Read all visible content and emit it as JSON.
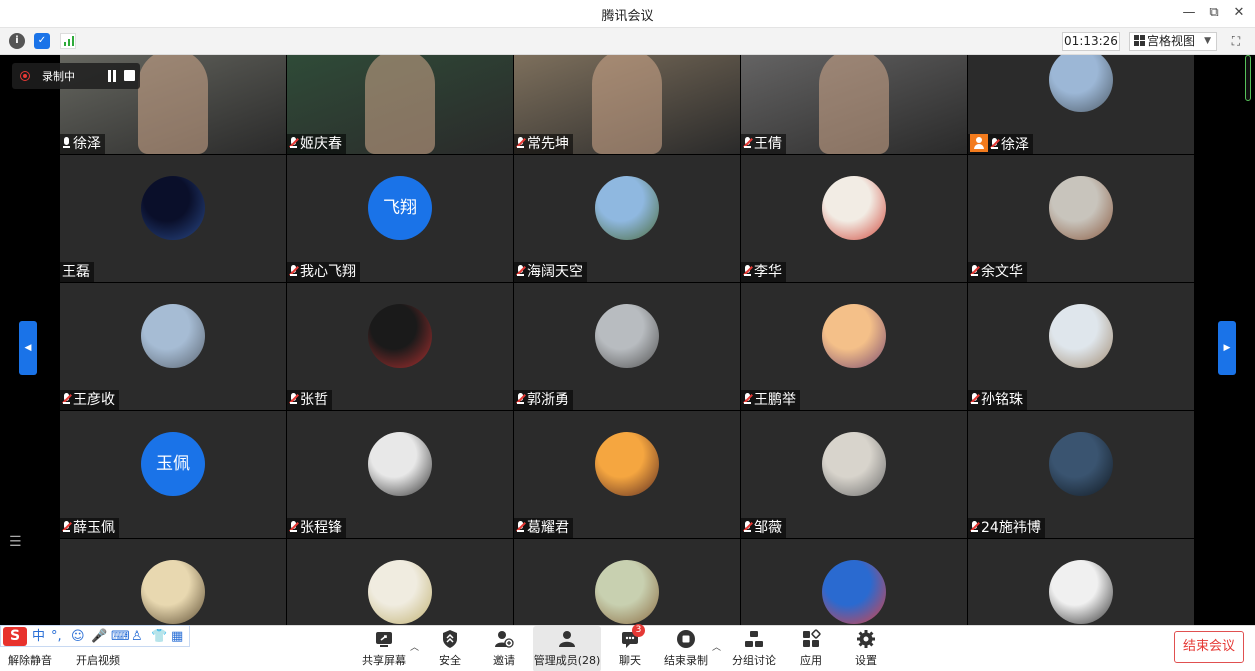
{
  "window": {
    "title": "腾讯会议",
    "minimize": "—",
    "restore": "⧉",
    "close": "✕"
  },
  "status": {
    "timer": "01:13:26",
    "view_label": "宫格视图",
    "view_caret": "▼",
    "fullscreen": "⛶",
    "info": "i",
    "shield": "✓"
  },
  "recording": {
    "label": "录制中"
  },
  "tiles": [
    {
      "name": "徐泽",
      "mic": "on",
      "kind": "video",
      "bg": "#6f7068"
    },
    {
      "name": "姬庆春",
      "mic": "muted",
      "kind": "video",
      "bg": "#30503a"
    },
    {
      "name": "常先坤",
      "mic": "muted",
      "kind": "video",
      "bg": "#8a7a64"
    },
    {
      "name": "王倩",
      "mic": "muted",
      "kind": "video",
      "bg": "#6d6c6c"
    },
    {
      "name": "徐泽",
      "mic": "muted",
      "kind": "avatar",
      "host": true,
      "c1": "#9cb7d6",
      "c2": "#4d5a66"
    },
    {
      "name": "王磊",
      "mic": "none",
      "kind": "avatar",
      "c1": "#0a0f2a",
      "c2": "#2a4a8a"
    },
    {
      "name": "我心飞翔",
      "mic": "muted",
      "kind": "text",
      "text": "飞翔"
    },
    {
      "name": "海阔天空",
      "mic": "muted",
      "kind": "avatar",
      "c1": "#8fb8e0",
      "c2": "#4a6a3a"
    },
    {
      "name": "李华",
      "mic": "muted",
      "kind": "avatar",
      "c1": "#f2ece4",
      "c2": "#d0473a"
    },
    {
      "name": "余文华",
      "mic": "muted",
      "kind": "avatar",
      "c1": "#c8c4bc",
      "c2": "#8a5a40"
    },
    {
      "name": "王彦收",
      "mic": "muted",
      "kind": "avatar",
      "c1": "#a6bcd4",
      "c2": "#5a6470"
    },
    {
      "name": "张哲",
      "mic": "muted",
      "kind": "avatar",
      "c1": "#1a1a1a",
      "c2": "#b03030"
    },
    {
      "name": "郭浙勇",
      "mic": "muted",
      "kind": "avatar",
      "c1": "#b8bcc0",
      "c2": "#505050"
    },
    {
      "name": "王鹏举",
      "mic": "muted",
      "kind": "avatar",
      "c1": "#f4c089",
      "c2": "#7a4a70"
    },
    {
      "name": "孙铭珠",
      "mic": "muted",
      "kind": "avatar",
      "c1": "#dfe6ec",
      "c2": "#a08a70"
    },
    {
      "name": "薛玉佩",
      "mic": "muted",
      "kind": "text",
      "text": "玉佩"
    },
    {
      "name": "张程锋",
      "mic": "muted",
      "kind": "avatar",
      "c1": "#e8e8e8",
      "c2": "#303030"
    },
    {
      "name": "葛耀君",
      "mic": "muted",
      "kind": "avatar",
      "c1": "#f5a640",
      "c2": "#5a2a20"
    },
    {
      "name": "邹薇",
      "mic": "muted",
      "kind": "avatar",
      "c1": "#d8d4cc",
      "c2": "#6a6a6a"
    },
    {
      "name": "24施祎博",
      "mic": "muted",
      "kind": "avatar",
      "c1": "#3a5470",
      "c2": "#101820"
    },
    {
      "name": "",
      "mic": "none",
      "kind": "avatar",
      "c1": "#e8d8b0",
      "c2": "#5a4a30"
    },
    {
      "name": "",
      "mic": "none",
      "kind": "avatar",
      "c1": "#f0ece0",
      "c2": "#c0b070"
    },
    {
      "name": "",
      "mic": "none",
      "kind": "avatar",
      "c1": "#c8d0b0",
      "c2": "#8a6a40"
    },
    {
      "name": "",
      "mic": "none",
      "kind": "avatar",
      "c1": "#2a6ad0",
      "c2": "#e04040"
    },
    {
      "name": "",
      "mic": "none",
      "kind": "avatar",
      "c1": "#f0f0f0",
      "c2": "#303030"
    }
  ],
  "toolbar": {
    "unmute": "解除静音",
    "start_video": "开启视频",
    "share": "共享屏幕",
    "security": "安全",
    "invite": "邀请",
    "members": "管理成员(28)",
    "chat": "聊天",
    "chat_badge": "3",
    "end_recording": "结束录制",
    "breakout": "分组讨论",
    "apps": "应用",
    "settings": "设置",
    "end_meeting": "结束会议"
  },
  "ime": {
    "brand": "S",
    "items": [
      "中",
      "°,",
      "☺",
      "🎤",
      "⌨",
      "♙",
      "👕",
      "▦"
    ]
  },
  "colors": {
    "accent": "#1a73e8",
    "danger": "#e53935",
    "host": "#f37b1d",
    "tile_bg": "#2b2b2b"
  }
}
